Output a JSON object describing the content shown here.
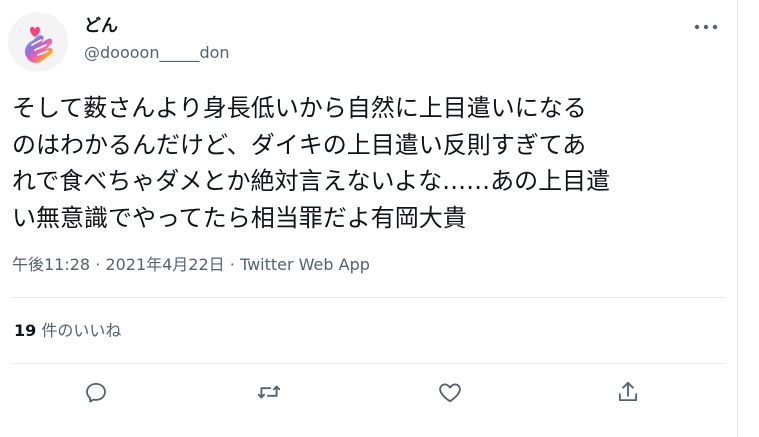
{
  "user": {
    "display_name": "どん",
    "handle": "@doooon_____don",
    "avatar_icon": "heart-hand-sign-avatar"
  },
  "tweet": {
    "text": "そして薮さんより身長低いから自然に上目遣いになる\nのはわかるんだけど、ダイキの上目遣い反則すぎてあ\nれで食べちゃダメとか絶対言えないよな……あの上目遣\nい無意識でやってたら相当罪だよ有岡大貴"
  },
  "meta": {
    "time": "午後11:28",
    "separator": "·",
    "date": "2021年4月22日",
    "source": "Twitter Web App"
  },
  "likes": {
    "count": "19",
    "label": " 件のいいね"
  },
  "actions": {
    "reply_icon": "reply-icon",
    "retweet_icon": "retweet-icon",
    "like_icon": "heart-icon",
    "share_icon": "share-icon"
  },
  "colors": {
    "text_primary": "#0f1419",
    "text_secondary": "#536471",
    "divider": "#e7e9ec",
    "icon": "#536471"
  }
}
